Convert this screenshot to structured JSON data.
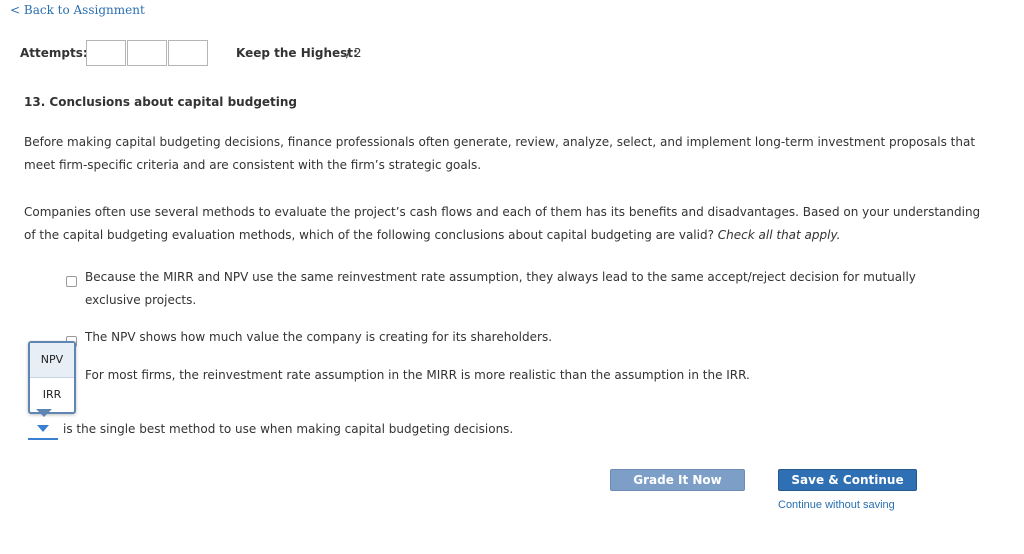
{
  "nav": {
    "back_label": "< Back to Assignment"
  },
  "attempts": {
    "label": "Attempts:",
    "keep_label": "Keep the Highest:",
    "keep_value": "/ 2"
  },
  "question": {
    "title": "13. Conclusions about capital budgeting",
    "intro": "Before making capital budgeting decisions, finance professionals often generate, review, analyze, select, and implement long-term investment proposals that meet firm-specific criteria and are consistent with the firm’s strategic goals.",
    "prompt": "Companies often use several methods to evaluate the project’s cash flows and each of them has its benefits and disadvantages. Based on your understanding of the capital budgeting evaluation methods, which of the following conclusions about capital budgeting are valid?",
    "prompt_hint": "Check all that apply.",
    "options": [
      "Because the MIRR and NPV use the same reinvestment rate assumption, they always lead to the same accept/reject decision for mutually exclusive projects.",
      "The NPV shows how much value the company is creating for its shareholders.",
      "For most firms, the reinvestment rate assumption in the MIRR is more realistic than the assumption in the IRR."
    ],
    "dropdown": {
      "options": [
        "NPV",
        "IRR"
      ],
      "suffix": "is the single best method to use when making capital budgeting decisions."
    }
  },
  "actions": {
    "grade_label": "Grade It Now",
    "save_label": "Save & Continue",
    "continue_label": "Continue without saving"
  },
  "colors": {
    "link": "#2a6fb0",
    "primary_button": "#2f6fb3",
    "secondary_button": "#7d9fc7",
    "dropdown_accent": "#3a7fd0"
  }
}
